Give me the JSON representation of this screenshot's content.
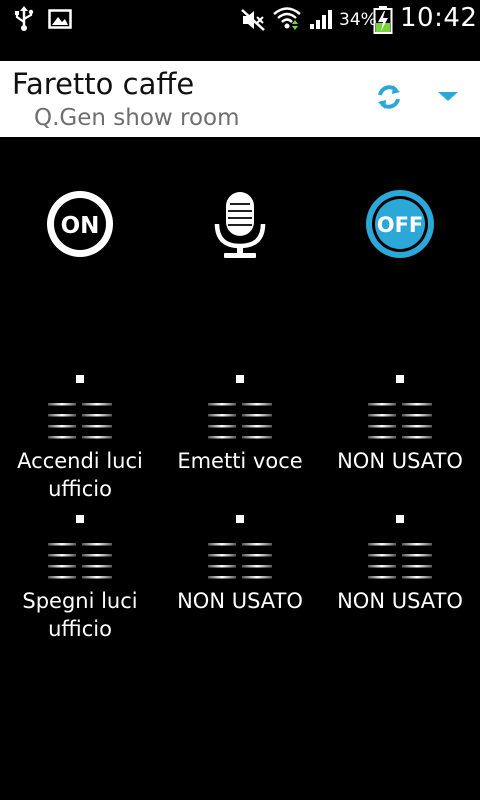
{
  "status_bar": {
    "battery_percent": "34%",
    "time": "10:42",
    "icons": [
      "usb-icon",
      "gallery-icon",
      "mute-icon",
      "wifi-icon",
      "signal-icon",
      "battery-charging-icon"
    ]
  },
  "header": {
    "device_name": "Faretto caffe",
    "room_name": "Q.Gen show room",
    "refresh_icon": "refresh-icon",
    "dropdown_icon": "dropdown-icon"
  },
  "actions": {
    "on_label": "ON",
    "off_label": "OFF",
    "mic_icon": "microphone-icon"
  },
  "grid": [
    {
      "line1": "Accendi luci",
      "line2": "ufficio"
    },
    {
      "line1": "Emetti voce",
      "line2": ""
    },
    {
      "line1": "NON USATO",
      "line2": ""
    },
    {
      "line1": "Spegni luci",
      "line2": "ufficio"
    },
    {
      "line1": "NON USATO",
      "line2": ""
    },
    {
      "line1": "NON USATO",
      "line2": ""
    }
  ],
  "colors": {
    "accent_blue": "#2ba8d8",
    "background": "#000000",
    "header_bg": "#ffffff"
  }
}
